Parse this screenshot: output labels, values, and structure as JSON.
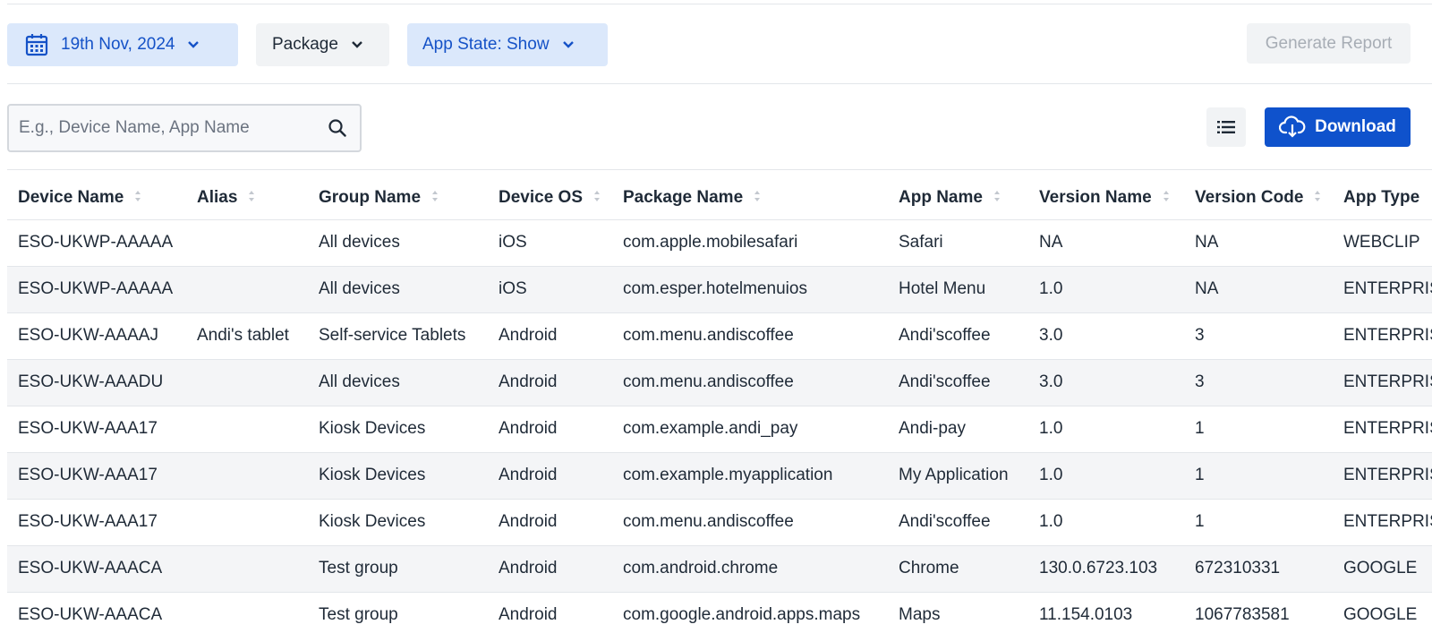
{
  "filters": {
    "date": {
      "label": "19th Nov, 2024",
      "icon": "calendar-icon"
    },
    "package": {
      "label": "Package"
    },
    "app_state": {
      "label": "App State: Show"
    },
    "generate_report": {
      "label": "Generate Report"
    }
  },
  "search": {
    "placeholder": "E.g., Device Name, App Name",
    "value": ""
  },
  "toolbar": {
    "download_label": "Download"
  },
  "colors": {
    "accent": "#0f52cc",
    "chip_bg": "#dbe8fb",
    "chip_text": "#1552c7"
  },
  "table": {
    "headers": [
      "Device Name",
      "Alias",
      "Group Name",
      "Device OS",
      "Package Name",
      "App Name",
      "Version Name",
      "Version Code",
      "App Type"
    ],
    "rows": [
      [
        "ESO-UKWP-AAAAA",
        "",
        "All devices",
        "iOS",
        "com.apple.mobilesafari",
        "Safari",
        "NA",
        "NA",
        "WEBCLIP"
      ],
      [
        "ESO-UKWP-AAAAA",
        "",
        "All devices",
        "iOS",
        "com.esper.hotelmenuios",
        "Hotel Menu",
        "1.0",
        "NA",
        "ENTERPRISE"
      ],
      [
        "ESO-UKW-AAAAJ",
        "Andi's tablet",
        "Self-service Tablets",
        "Android",
        "com.menu.andiscoffee",
        "Andi'scoffee",
        "3.0",
        "3",
        "ENTERPRISE"
      ],
      [
        "ESO-UKW-AAADU",
        "",
        "All devices",
        "Android",
        "com.menu.andiscoffee",
        "Andi'scoffee",
        "3.0",
        "3",
        "ENTERPRISE"
      ],
      [
        "ESO-UKW-AAA17",
        "",
        "Kiosk Devices",
        "Android",
        "com.example.andi_pay",
        "Andi-pay",
        "1.0",
        "1",
        "ENTERPRISE"
      ],
      [
        "ESO-UKW-AAA17",
        "",
        "Kiosk Devices",
        "Android",
        "com.example.myapplication",
        "My Application",
        "1.0",
        "1",
        "ENTERPRISE"
      ],
      [
        "ESO-UKW-AAA17",
        "",
        "Kiosk Devices",
        "Android",
        "com.menu.andiscoffee",
        "Andi'scoffee",
        "1.0",
        "1",
        "ENTERPRISE"
      ],
      [
        "ESO-UKW-AAACA",
        "",
        "Test group",
        "Android",
        "com.android.chrome",
        "Chrome",
        "130.0.6723.103",
        "672310331",
        "GOOGLE"
      ],
      [
        "ESO-UKW-AAACA",
        "",
        "Test group",
        "Android",
        "com.google.android.apps.maps",
        "Maps",
        "11.154.0103",
        "1067783581",
        "GOOGLE"
      ]
    ]
  }
}
